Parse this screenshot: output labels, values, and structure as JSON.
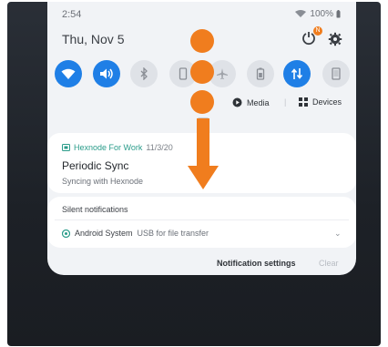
{
  "status_bar": {
    "time": "2:54",
    "battery": "100%",
    "wifi_icon": "wifi-signal-icon",
    "battery_icon": "battery-icon"
  },
  "header": {
    "date": "Thu, Nov 5",
    "edit_badge": "N"
  },
  "quick_toggles": [
    {
      "name": "wifi",
      "icon": "wifi-icon",
      "state": "on"
    },
    {
      "name": "sound",
      "icon": "volume-icon",
      "state": "on"
    },
    {
      "name": "bluetooth",
      "icon": "bluetooth-icon",
      "state": "off"
    },
    {
      "name": "rotation",
      "icon": "phone-rotate-icon",
      "state": "off"
    },
    {
      "name": "airplane",
      "icon": "airplane-icon",
      "state": "off"
    },
    {
      "name": "battery-saver",
      "icon": "battery-saver-icon",
      "state": "off"
    },
    {
      "name": "mobile-data",
      "icon": "data-arrows-icon",
      "state": "on"
    },
    {
      "name": "screen",
      "icon": "phone-screen-icon",
      "state": "off"
    }
  ],
  "media_bar": {
    "media_label": "Media",
    "devices_label": "Devices"
  },
  "notification": {
    "app": "Hexnode For Work",
    "time": "11/3/20",
    "title": "Periodic Sync",
    "text": "Syncing with Hexnode"
  },
  "silent": {
    "heading": "Silent notifications",
    "app": "Android System",
    "text": "USB for file transfer"
  },
  "footer": {
    "settings_label": "Notification settings",
    "clear_label": "Clear"
  },
  "colors": {
    "accent": "#1f7fe6",
    "annotation": "#f07d1e",
    "app_green": "#2a9c8a"
  }
}
